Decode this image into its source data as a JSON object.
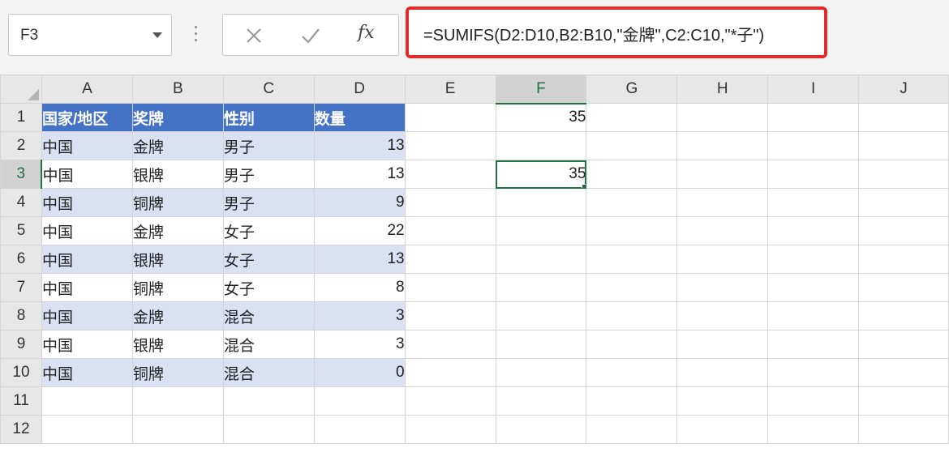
{
  "name_box": {
    "value": "F3"
  },
  "formula_bar": {
    "fx_label": "fx",
    "formula": "=SUMIFS(D2:D10,B2:B10,\"金牌\",C2:C10,\"*子\")"
  },
  "columns": [
    "A",
    "B",
    "C",
    "D",
    "E",
    "F",
    "G",
    "H",
    "I",
    "J"
  ],
  "rows": [
    "1",
    "2",
    "3",
    "4",
    "5",
    "6",
    "7",
    "8",
    "9",
    "10",
    "11",
    "12"
  ],
  "table": {
    "headers": [
      "国家/地区",
      "奖牌",
      "性别",
      "数量"
    ],
    "data": [
      [
        "中国",
        "金牌",
        "男子",
        "13"
      ],
      [
        "中国",
        "银牌",
        "男子",
        "13"
      ],
      [
        "中国",
        "铜牌",
        "男子",
        "9"
      ],
      [
        "中国",
        "金牌",
        "女子",
        "22"
      ],
      [
        "中国",
        "银牌",
        "女子",
        "13"
      ],
      [
        "中国",
        "铜牌",
        "女子",
        "8"
      ],
      [
        "中国",
        "金牌",
        "混合",
        "3"
      ],
      [
        "中国",
        "银牌",
        "混合",
        "3"
      ],
      [
        "中国",
        "铜牌",
        "混合",
        "0"
      ]
    ]
  },
  "f_column": {
    "F1": "35",
    "F3": "35"
  },
  "colors": {
    "header_fill": "#4472c4",
    "band_fill": "#d9e1f2",
    "highlight_border": "#e12b2b",
    "selection": "#217346"
  }
}
